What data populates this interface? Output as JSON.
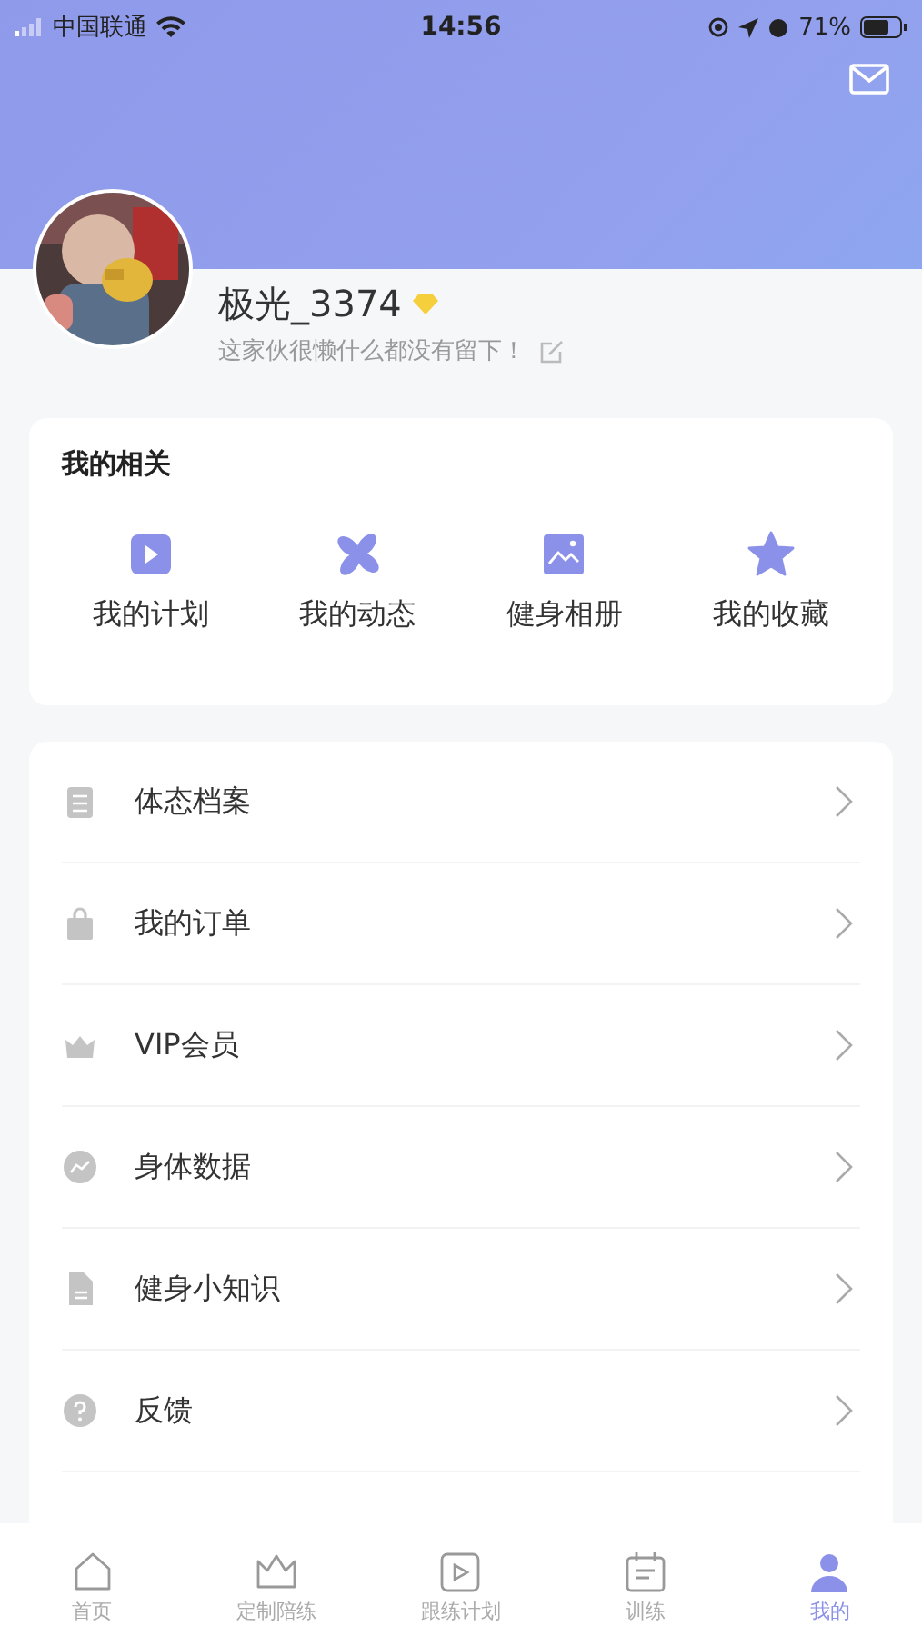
{
  "status_bar": {
    "carrier": "中国联通",
    "time": "14:56",
    "battery": "71%"
  },
  "profile": {
    "name": "极光_3374",
    "bio": "这家伙很懒什么都没有留下！"
  },
  "related": {
    "title": "我的相关",
    "items": [
      {
        "label": "我的计划"
      },
      {
        "label": "我的动态"
      },
      {
        "label": "健身相册"
      },
      {
        "label": "我的收藏"
      }
    ]
  },
  "menu": [
    {
      "label": "体态档案"
    },
    {
      "label": "我的订单"
    },
    {
      "label": "VIP会员"
    },
    {
      "label": "身体数据"
    },
    {
      "label": "健身小知识"
    },
    {
      "label": "反馈"
    }
  ],
  "tabs": [
    {
      "label": "首页",
      "selected": false
    },
    {
      "label": "定制陪练",
      "selected": false
    },
    {
      "label": "跟练计划",
      "selected": false
    },
    {
      "label": "训练",
      "selected": false
    },
    {
      "label": "我的",
      "selected": true
    }
  ]
}
